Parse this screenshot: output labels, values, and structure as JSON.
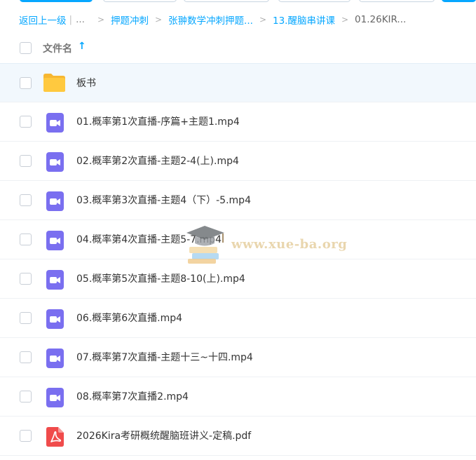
{
  "breadcrumb": {
    "back": "返回上一级",
    "more": "...",
    "items": [
      "押题冲刺",
      "张翀数学冲刺押题...",
      "13.醒脑串讲课"
    ],
    "current": "01.26KIR..."
  },
  "list_header": {
    "label": "文件名",
    "sort_arrow": "↑"
  },
  "files": [
    {
      "name": "板书",
      "icon": "folder-icon"
    },
    {
      "name": "01.概率第1次直播-序篇+主题1.mp4",
      "icon": "video-icon"
    },
    {
      "name": "02.概率第2次直播-主题2-4(上).mp4",
      "icon": "video-icon"
    },
    {
      "name": "03.概率第3次直播-主题4（下）-5.mp4",
      "icon": "video-icon"
    },
    {
      "name": "04.概率第4次直播-主题5-7.mp4",
      "icon": "video-icon"
    },
    {
      "name": "05.概率第5次直播-主题8-10(上).mp4",
      "icon": "video-icon"
    },
    {
      "name": "06.概率第6次直播.mp4",
      "icon": "video-icon"
    },
    {
      "name": "07.概率第7次直播-主题十三~十四.mp4",
      "icon": "video-icon"
    },
    {
      "name": "08.概率第7次直播2.mp4",
      "icon": "video-icon"
    },
    {
      "name": "2026Kira考研概统醒脑班讲义-定稿.pdf",
      "icon": "pdf-icon"
    }
  ],
  "watermark": {
    "text": "www.xue-ba.org",
    "icon": "graduation-cap-books-icon"
  },
  "colors": {
    "accent": "#06a7ff",
    "folder": "#ffc53d",
    "video": "#7a6ff0",
    "pdf": "#f04b4b",
    "row_highlight": "#f2f8fd"
  }
}
